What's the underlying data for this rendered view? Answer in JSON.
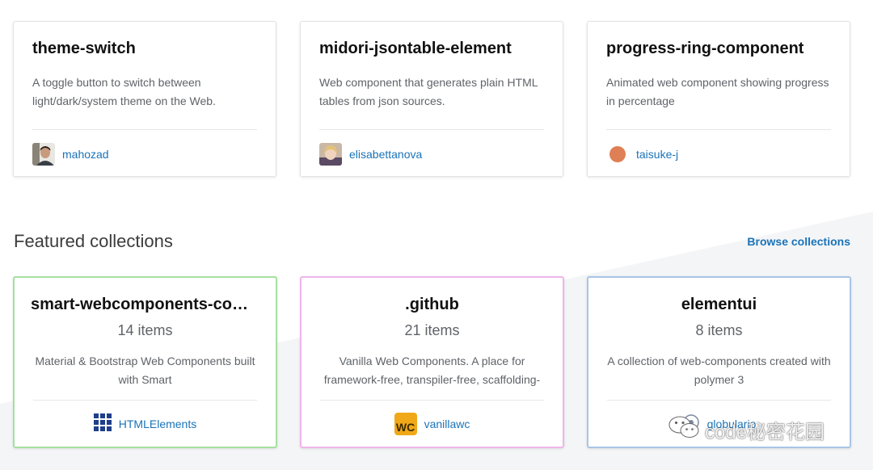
{
  "elements": [
    {
      "title": "theme-switch",
      "description": "A toggle button to switch between light/dark/system theme on the Web.",
      "author": "mahozad",
      "avatar": "photo-avatar-dark"
    },
    {
      "title": "midori-jsontable-element",
      "description": "Web component that generates plain HTML tables from json sources.",
      "author": "elisabettanova",
      "avatar": "photo-avatar-light"
    },
    {
      "title": "progress-ring-component",
      "description": "Animated web component showing progress in percentage",
      "author": "taisuke-j",
      "avatar": "orange-circle-avatar"
    }
  ],
  "collections_section": {
    "title": "Featured collections",
    "browse_label": "Browse collections",
    "items": [
      {
        "title": "smart-webcomponents-com…",
        "count": "14 items",
        "description": "Material & Bootstrap Web Components built with Smart",
        "owner": "HTMLElements",
        "border_color": "#a6e0a0",
        "icon": "grid-icon"
      },
      {
        "title": ".github",
        "count": "21 items",
        "description": "Vanilla Web Components. A place for framework-free, transpiler-free, scaffolding-free",
        "owner": "vanillawc",
        "border_color": "#f0b5ea",
        "icon": "wc-logo-icon",
        "logo_text": "WC"
      },
      {
        "title": "elementui",
        "count": "8 items",
        "description": "A collection of web-components created with polymer 3",
        "owner": "globulario",
        "border_color": "#a9c5e6",
        "icon": "globulario-icon"
      }
    ]
  },
  "watermark": {
    "text": "code秘密花园"
  }
}
